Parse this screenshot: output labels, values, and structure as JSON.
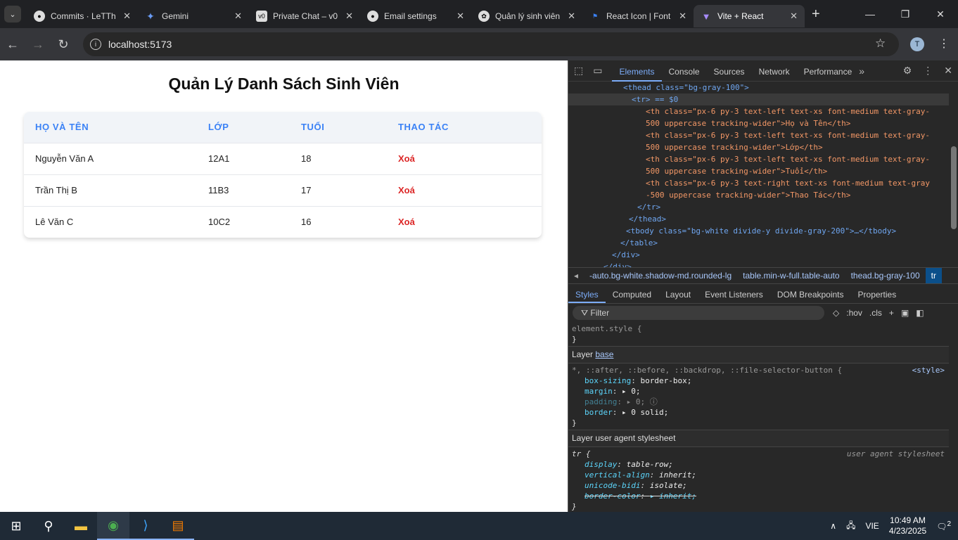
{
  "browser": {
    "tabs": [
      {
        "title": "Commits · LeTTh",
        "icon": "github-icon"
      },
      {
        "title": "Gemini",
        "icon": "gemini-icon"
      },
      {
        "title": "Private Chat – v0",
        "icon": "v0-icon"
      },
      {
        "title": "Email settings",
        "icon": "github-icon"
      },
      {
        "title": "Quản lý sinh viên",
        "icon": "openai-icon"
      },
      {
        "title": "React Icon | Font",
        "icon": "flag-icon"
      },
      {
        "title": "Vite + React",
        "icon": "vite-icon"
      }
    ],
    "url": "localhost:5173",
    "profile_initial": "T"
  },
  "app": {
    "title": "Quản Lý Danh Sách Sinh Viên",
    "columns": [
      "HỌ VÀ TÊN",
      "LỚP",
      "TUỔI",
      "THAO TÁC"
    ],
    "rows": [
      {
        "name": "Nguyễn Văn A",
        "class": "12A1",
        "age": "18",
        "action": "Xoá"
      },
      {
        "name": "Trần Thị B",
        "class": "11B3",
        "age": "17",
        "action": "Xoá"
      },
      {
        "name": "Lê Văn C",
        "class": "10C2",
        "age": "16",
        "action": "Xoá"
      }
    ]
  },
  "devtools": {
    "tabs": [
      "Elements",
      "Console",
      "Sources",
      "Network",
      "Performance"
    ],
    "dom": {
      "thead_open": "<thead class=\"bg-gray-100\">",
      "tr_open": "<tr> == $0",
      "th1a": "<th class=\"px-6 py-3 text-left text-xs font-medium text-gray-",
      "th1b": "500 uppercase tracking-wider\">Họ và Tên</th>",
      "th2a": "<th class=\"px-6 py-3 text-left text-xs font-medium text-gray-",
      "th2b": "500 uppercase tracking-wider\">Lớp</th>",
      "th3a": "<th class=\"px-6 py-3 text-left text-xs font-medium text-gray-",
      "th3b": "500 uppercase tracking-wider\">Tuổi</th>",
      "th4a": "<th class=\"px-6 py-3 text-right text-xs font-medium text-gray",
      "th4b": "-500 uppercase tracking-wider\">Thao Tác</th>",
      "tr_close": "</tr>",
      "thead_close": "</thead>",
      "tbody": "<tbody class=\"bg-white divide-y divide-gray-200\">…</tbody>",
      "table_close": "</table>",
      "div_close": "</div>",
      "div_close2": "</div>"
    },
    "breadcrumbs": [
      "-auto.bg-white.shadow-md.rounded-lg",
      "table.min-w-full.table-auto",
      "thead.bg-gray-100",
      "tr"
    ],
    "subtabs": [
      "Styles",
      "Computed",
      "Layout",
      "Event Listeners",
      "DOM Breakpoints",
      "Properties"
    ],
    "filter_placeholder": "Filter",
    "filter_tools": [
      ":hov",
      ".cls"
    ],
    "styles": {
      "element_style": "element.style {",
      "close": "}",
      "layer_label": "Layer",
      "layer_link": "base",
      "selector": "*, ::after, ::before, ::backdrop, ::file-selector-button {",
      "source": "<style>",
      "props": [
        {
          "name": "box-sizing",
          "value": "border-box;"
        },
        {
          "name": "margin",
          "value": "▸ 0;"
        },
        {
          "name": "padding",
          "value": "▸ 0; ⓘ"
        },
        {
          "name": "border",
          "value": "▸ 0 solid;"
        }
      ],
      "ua_layer": "Layer user agent stylesheet",
      "ua_selector": "tr {",
      "ua_source": "user agent stylesheet",
      "ua_props": [
        {
          "name": "display",
          "value": "table-row;"
        },
        {
          "name": "vertical-align",
          "value": "inherit;"
        },
        {
          "name": "unicode-bidi",
          "value": "isolate;"
        },
        {
          "name": "border-color",
          "value": "▸ inherit;"
        }
      ]
    }
  },
  "taskbar": {
    "lang": "VIE",
    "time": "10:49 AM",
    "date": "4/23/2025",
    "notifications": "2"
  }
}
